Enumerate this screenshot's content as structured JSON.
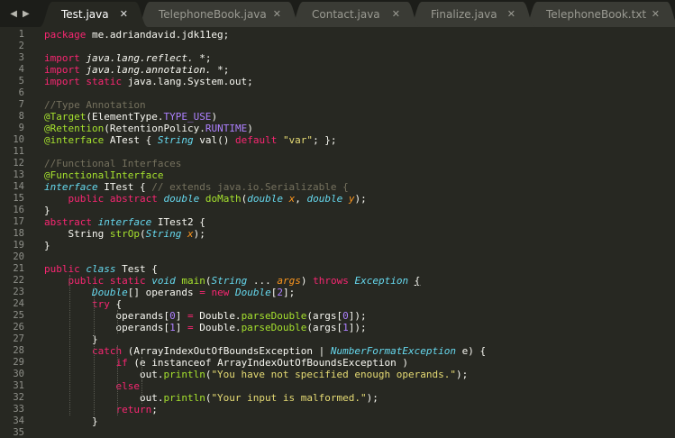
{
  "tabs": [
    {
      "label": "Test.java",
      "active": true
    },
    {
      "label": "TelephoneBook.java",
      "active": false
    },
    {
      "label": "Contact.java",
      "active": false
    },
    {
      "label": "Finalize.java",
      "active": false
    },
    {
      "label": "TelephoneBook.txt",
      "active": false
    }
  ],
  "tab_close_glyph": "✕",
  "nav": {
    "back": "◀",
    "forward": "▶"
  },
  "icons": {
    "back": "chevron-left-icon",
    "forward": "chevron-right-icon",
    "close": "close-icon"
  },
  "colors": {
    "background": "#272822",
    "keyword": "#f92672",
    "type": "#66d9ef",
    "comment": "#75715e",
    "string": "#e6db74",
    "function": "#a6e22e",
    "constant": "#ae81ff",
    "argument": "#fd971f"
  },
  "lines": [
    [
      [
        "kw",
        "package"
      ],
      [
        "",
        "me.adriandavid.jdk11eg;"
      ]
    ],
    [],
    [
      [
        "kw",
        "import"
      ],
      [
        "",
        ""
      ],
      [
        "it",
        "java.lang.reflect."
      ],
      [
        "",
        "*;"
      ]
    ],
    [
      [
        "kw",
        "import"
      ],
      [
        "",
        ""
      ],
      [
        "it",
        "java.lang.annotation."
      ],
      [
        "",
        "*;"
      ]
    ],
    [
      [
        "kw",
        "import static"
      ],
      [
        "",
        "java.lang.System.out;"
      ]
    ],
    [],
    [
      [
        "cm",
        "//Type Annotation"
      ]
    ],
    [
      [
        "fn",
        "@Target"
      ],
      [
        "",
        "(ElementType."
      ],
      [
        "ct",
        "TYPE_USE"
      ],
      [
        "",
        ")"
      ]
    ],
    [
      [
        "fn",
        "@Retention"
      ],
      [
        "",
        "(RetentionPolicy."
      ],
      [
        "ct",
        "RUNTIME"
      ],
      [
        "",
        ")"
      ]
    ],
    [
      [
        "fn",
        "@interface"
      ],
      [
        "",
        "ATest { "
      ],
      [
        "ty",
        "String"
      ],
      [
        "",
        "val() "
      ],
      [
        "kw",
        "default"
      ],
      [
        "",
        ""
      ],
      [
        "st",
        "\"var\""
      ],
      [
        "",
        "; };"
      ]
    ],
    [],
    [
      [
        "cm",
        "//Functional Interfaces"
      ]
    ],
    [
      [
        "fn",
        "@FunctionalInterface"
      ]
    ],
    [
      [
        "ty",
        "interface"
      ],
      [
        "",
        "ITest { "
      ],
      [
        "cm",
        "// extends java.io.Serializable {"
      ]
    ],
    [
      [
        "",
        "    "
      ],
      [
        "kw",
        "public abstract"
      ],
      [
        "",
        ""
      ],
      [
        "ty",
        "double"
      ],
      [
        "",
        ""
      ],
      [
        "fn",
        "doMath"
      ],
      [
        "",
        "("
      ],
      [
        "ty",
        "double"
      ],
      [
        "",
        ""
      ],
      [
        "ar",
        "x"
      ],
      [
        "",
        ", "
      ],
      [
        "ty",
        "double"
      ],
      [
        "",
        ""
      ],
      [
        "ar",
        "y"
      ],
      [
        "",
        ");"
      ]
    ],
    [
      [
        "",
        "}"
      ]
    ],
    [
      [
        "kw",
        "abstract"
      ],
      [
        "",
        ""
      ],
      [
        "ty",
        "interface"
      ],
      [
        "",
        "ITest2 {"
      ]
    ],
    [
      [
        "",
        "    String "
      ],
      [
        "fn",
        "strOp"
      ],
      [
        "",
        "("
      ],
      [
        "ty",
        "String"
      ],
      [
        "",
        ""
      ],
      [
        "ar",
        "x"
      ],
      [
        "",
        ");"
      ]
    ],
    [
      [
        "",
        "}"
      ]
    ],
    [],
    [
      [
        "kw",
        "public"
      ],
      [
        "",
        ""
      ],
      [
        "ty",
        "class"
      ],
      [
        "",
        "Test {"
      ]
    ],
    [
      [
        "",
        "    "
      ],
      [
        "kw",
        "public static"
      ],
      [
        "",
        ""
      ],
      [
        "ty",
        "void"
      ],
      [
        "",
        ""
      ],
      [
        "fn",
        "main"
      ],
      [
        "",
        "("
      ],
      [
        "ty",
        "String"
      ],
      [
        "",
        " ... "
      ],
      [
        "ar",
        "args"
      ],
      [
        "",
        ") "
      ],
      [
        "kw",
        "throws"
      ],
      [
        "",
        ""
      ],
      [
        "ty",
        "Exception"
      ],
      [
        "",
        ""
      ],
      [
        "ul",
        "{"
      ]
    ],
    [
      [
        "",
        "        "
      ],
      [
        "ty",
        "Double"
      ],
      [
        "",
        "[] operands "
      ],
      [
        "kw",
        "="
      ],
      [
        "",
        ""
      ],
      [
        "kw",
        "new"
      ],
      [
        "",
        ""
      ],
      [
        "ty",
        "Double"
      ],
      [
        "",
        "["
      ],
      [
        "ct",
        "2"
      ],
      [
        "",
        "];"
      ]
    ],
    [
      [
        "",
        "        "
      ],
      [
        "kw",
        "try"
      ],
      [
        "",
        " {"
      ]
    ],
    [
      [
        "",
        "            operands["
      ],
      [
        "ct",
        "0"
      ],
      [
        "",
        "] "
      ],
      [
        "kw",
        "="
      ],
      [
        "",
        "Double."
      ],
      [
        "fn",
        "parseDouble"
      ],
      [
        "",
        "(args["
      ],
      [
        "ct",
        "0"
      ],
      [
        "",
        "]);"
      ]
    ],
    [
      [
        "",
        "            operands["
      ],
      [
        "ct",
        "1"
      ],
      [
        "",
        "] "
      ],
      [
        "kw",
        "="
      ],
      [
        "",
        "Double."
      ],
      [
        "fn",
        "parseDouble"
      ],
      [
        "",
        "(args["
      ],
      [
        "ct",
        "1"
      ],
      [
        "",
        "]);"
      ]
    ],
    [
      [
        "",
        "        }"
      ]
    ],
    [
      [
        "",
        "        "
      ],
      [
        "kw",
        "catch"
      ],
      [
        "",
        " (ArrayIndexOutOfBoundsException | "
      ],
      [
        "ty",
        "NumberFormatException"
      ],
      [
        "",
        " e) {"
      ]
    ],
    [
      [
        "",
        "            "
      ],
      [
        "kw",
        "if"
      ],
      [
        "",
        " (e instanceof ArrayIndexOutOfBoundsException )"
      ]
    ],
    [
      [
        "",
        "                out."
      ],
      [
        "fn",
        "println"
      ],
      [
        "",
        "("
      ],
      [
        "st",
        "\"You have not specified enough operands.\""
      ],
      [
        "",
        ");"
      ]
    ],
    [
      [
        "",
        "            "
      ],
      [
        "kw",
        "else"
      ]
    ],
    [
      [
        "",
        "                out."
      ],
      [
        "fn",
        "println"
      ],
      [
        "",
        "("
      ],
      [
        "st",
        "\"Your input is malformed.\""
      ],
      [
        "",
        ");"
      ]
    ],
    [
      [
        "",
        "            "
      ],
      [
        "kw",
        "return"
      ],
      [
        "",
        ";"
      ]
    ],
    [
      [
        "",
        "        }"
      ]
    ],
    []
  ]
}
